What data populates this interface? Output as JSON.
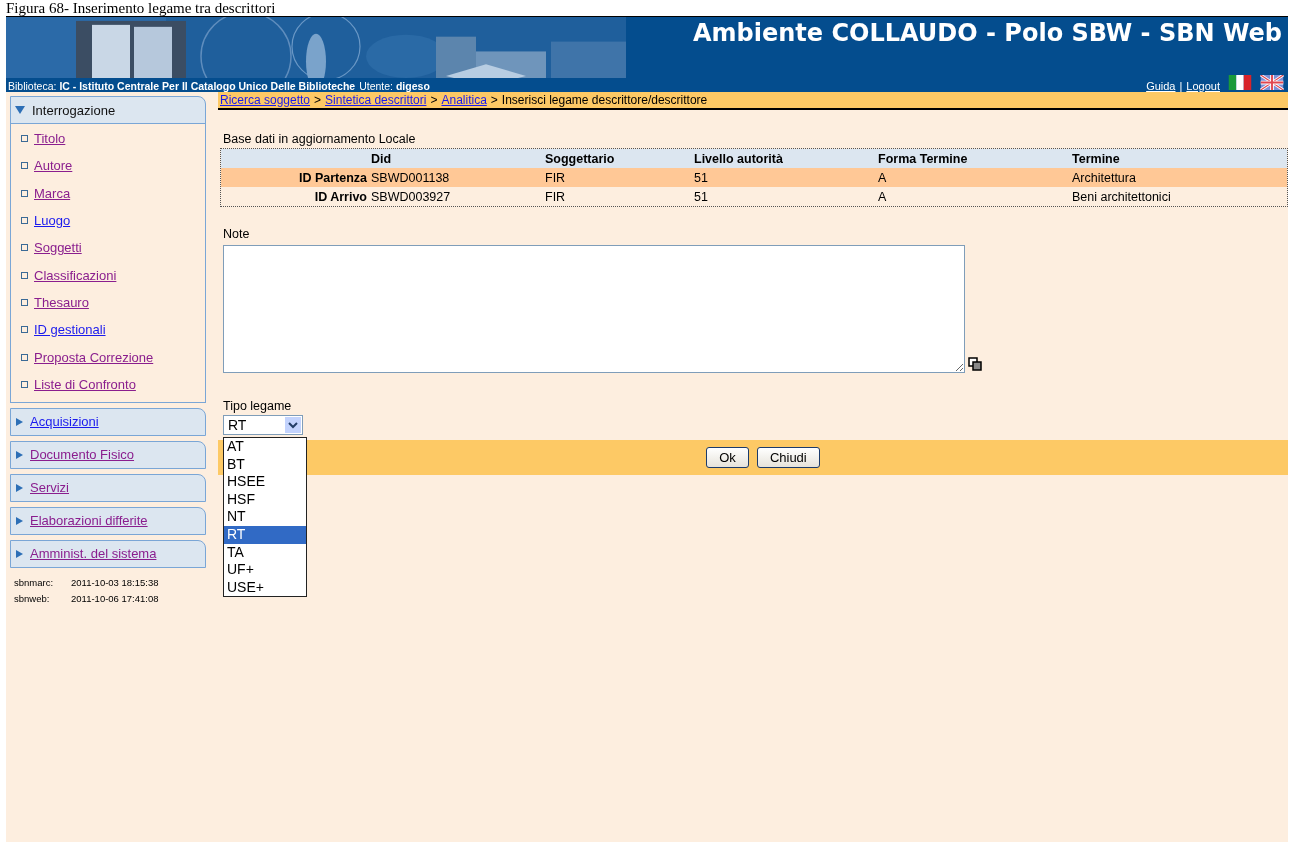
{
  "caption": "Figura 68- Inserimento legame tra descrittori",
  "header": {
    "title": "Ambiente COLLAUDO - Polo SBW - SBN Web",
    "library_label": "Biblioteca:",
    "library_code": "IC",
    "library_name": " - Istituto Centrale Per Il Catalogo Unico Delle Biblioteche",
    "user_label": "Utente:",
    "user": "digeso",
    "links": [
      "Guida",
      "Logout"
    ],
    "separator": "|"
  },
  "breadcrumb": {
    "links": [
      "Ricerca soggetto",
      "Sintetica descrittori",
      "Analitica"
    ],
    "separator": ">",
    "current": "Inserisci legame descrittore/descrittore"
  },
  "sidebar": {
    "sections": [
      {
        "label": "Interrogazione",
        "expanded": true,
        "items": [
          {
            "label": "Titolo",
            "visited": true
          },
          {
            "label": "Autore",
            "visited": true
          },
          {
            "label": "Marca",
            "visited": true
          },
          {
            "label": "Luogo",
            "visited": false
          },
          {
            "label": "Soggetti",
            "visited": true
          },
          {
            "label": "Classificazioni",
            "visited": true
          },
          {
            "label": "Thesauro",
            "visited": true
          },
          {
            "label": "ID gestionali",
            "visited": false
          },
          {
            "label": "Proposta Correzione",
            "visited": true
          },
          {
            "label": "Liste di Confronto",
            "visited": true
          }
        ]
      },
      {
        "label": "Acquisizioni",
        "expanded": false,
        "visited": false
      },
      {
        "label": "Documento Fisico",
        "expanded": false,
        "visited": true
      },
      {
        "label": "Servizi",
        "expanded": false,
        "visited": true
      },
      {
        "label": "Elaborazioni differite",
        "expanded": false,
        "visited": true
      },
      {
        "label": "Amminist. del sistema",
        "expanded": false,
        "visited": true
      }
    ],
    "timestamps": [
      {
        "name": "sbnmarc:",
        "value": "2011-10-03 18:15:38"
      },
      {
        "name": "sbnweb:",
        "value": "2011-10-06 17:41:08"
      }
    ]
  },
  "database_note": "Base dati in aggiornamento Locale",
  "table": {
    "columns": [
      "",
      "Did",
      "Soggettario",
      "Livello autorità",
      "Forma Termine",
      "Termine"
    ],
    "rows": [
      {
        "selected": true,
        "cells": [
          "ID Partenza",
          "SBWD001138",
          "FIR",
          "51",
          "A",
          "Architettura"
        ]
      },
      {
        "selected": false,
        "cells": [
          "ID Arrivo",
          "SBWD003927",
          "FIR",
          "51",
          "A",
          "Beni architettonici"
        ]
      }
    ]
  },
  "note": {
    "label": "Note"
  },
  "link_type": {
    "label": "Tipo legame",
    "value": "RT",
    "expanded": true,
    "options": [
      {
        "label": "AT",
        "selected": false
      },
      {
        "label": "BT",
        "selected": false
      },
      {
        "label": "HSEE",
        "selected": false
      },
      {
        "label": "HSF",
        "selected": false
      },
      {
        "label": "NT",
        "selected": false
      },
      {
        "label": "RT",
        "selected": true
      },
      {
        "label": "TA",
        "selected": false
      },
      {
        "label": "UF+",
        "selected": false
      },
      {
        "label": "USE+",
        "selected": false
      }
    ]
  },
  "buttons": [
    "Ok",
    "Chiudi"
  ]
}
